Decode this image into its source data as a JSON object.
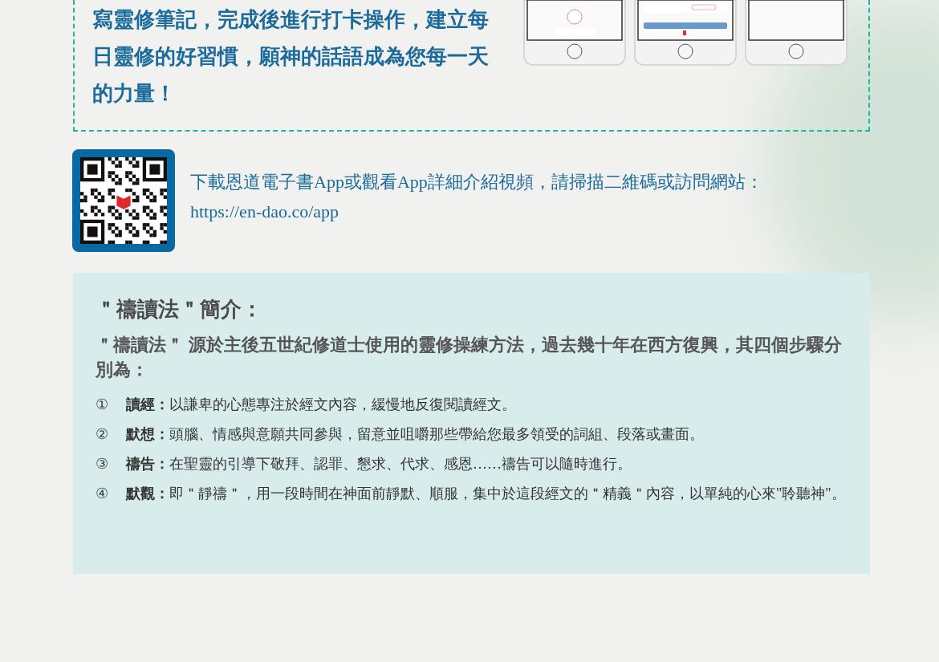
{
  "feature_box": {
    "description": "寫靈修筆記，完成後進行打卡操作，建立每日靈修的好習慣，願神的話語成為您每一天的力量！",
    "phones": [
      {
        "kind": "checkin"
      },
      {
        "kind": "list"
      },
      {
        "kind": "blank"
      }
    ]
  },
  "download": {
    "text": "下載恩道電子書App或觀看App詳細介紹視頻，請掃描二維碼或訪問網站：",
    "url": "https://en-dao.co/app"
  },
  "intro": {
    "title": "＂禱讀法＂簡介：",
    "paragraph": "＂禱讀法＂ 源於主後五世紀修道士使用的靈修操練方法，過去幾十年在西方復興，其四個步驟分別為：",
    "steps": [
      {
        "number": "①",
        "text": "**讀經：**以謙卑的心態專注於經文內容，緩慢地反復閱讀經文。"
      },
      {
        "number": "②",
        "text": "**默想：**頭腦、情感與意願共同參與，留意並咀嚼那些帶給您最多領受的詞組、段落或畫面。"
      },
      {
        "number": "③",
        "text": "**禱告：**在聖靈的引導下敬拜、認罪、懇求、代求、感恩……禱告可以隨時進行。"
      },
      {
        "number": "④",
        "text": "**默觀：**即＂靜禱＂，用一段時間在神面前靜默、順服，集中於這段經文的＂精義＂內容，以單純的心來\"聆聽神\"。"
      }
    ]
  }
}
